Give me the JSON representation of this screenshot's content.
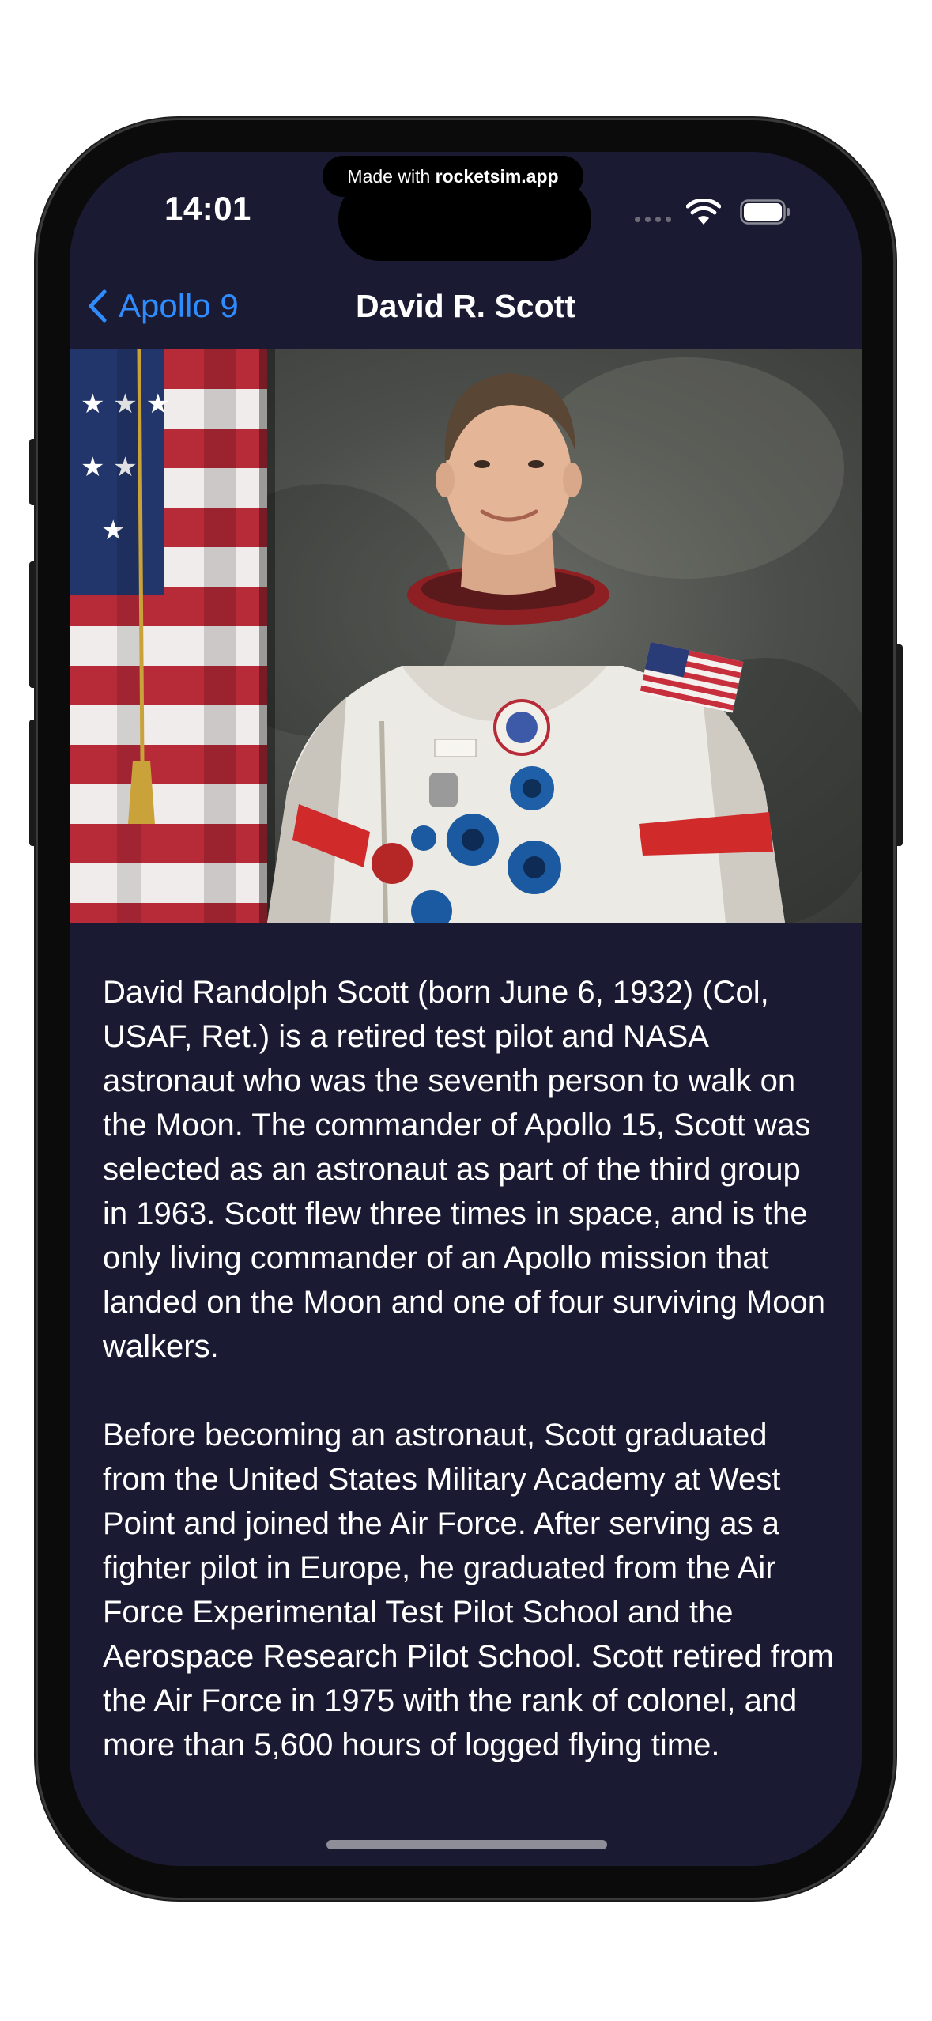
{
  "status_bar": {
    "time": "14:01",
    "made_with_prefix": "Made with ",
    "made_with_brand": "rocketsim.app",
    "icons": [
      "cellular-dots-icon",
      "wifi-icon",
      "battery-icon"
    ]
  },
  "nav": {
    "back_label": "Apollo 9",
    "title": "David R. Scott",
    "accent_color": "#2f8cff"
  },
  "photo": {
    "subject": "astronaut portrait with american flag"
  },
  "bio": {
    "paragraphs": [
      "David Randolph Scott (born June 6, 1932) (Col, USAF, Ret.) is a retired test pilot and NASA astronaut who was the seventh person to walk on the Moon. The commander of Apollo 15, Scott was selected as an astronaut as part of the third group in 1963. Scott flew three times in space, and is the only living commander of an Apollo mission that landed on the Moon and one of four surviving Moon walkers.",
      "Before becoming an astronaut, Scott graduated from the United States Military Academy at West Point and joined the Air Force. After serving as a fighter pilot in Europe, he graduated from the Air Force Experimental Test Pilot School and the Aerospace Research Pilot School. Scott retired from the Air Force in 1975 with the rank of colonel, and more than 5,600 hours of logged flying time."
    ]
  },
  "colors": {
    "background": "#1a1a33",
    "text": "#ffffff"
  }
}
